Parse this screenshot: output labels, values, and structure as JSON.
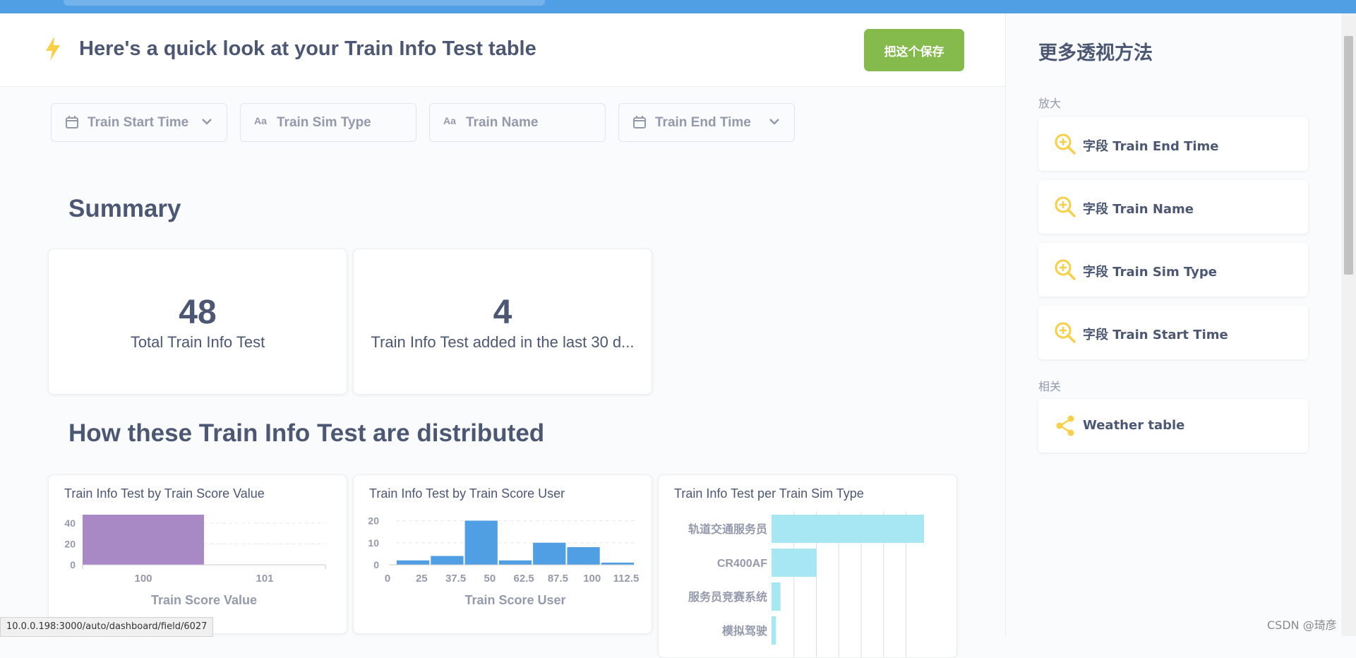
{
  "header": {
    "title": "Here's a quick look at your Train Info Test table",
    "save_label": "把这个保存"
  },
  "filters": [
    {
      "label": "Train Start Time",
      "icon": "calendar-icon",
      "has_dropdown": true
    },
    {
      "label": "Train Sim Type",
      "icon": "text-type-icon",
      "icon_text": "Aa",
      "has_dropdown": false
    },
    {
      "label": "Train Name",
      "icon": "text-type-icon",
      "icon_text": "Aa",
      "has_dropdown": false
    },
    {
      "label": "Train End Time",
      "icon": "calendar-icon",
      "has_dropdown": true
    }
  ],
  "summary": {
    "title": "Summary",
    "cards": [
      {
        "value": "48",
        "label": "Total Train Info Test"
      },
      {
        "value": "4",
        "label": "Train Info Test added in the last 30 d..."
      }
    ]
  },
  "distribution": {
    "title": "How these Train Info Test are distributed"
  },
  "chart_data": [
    {
      "type": "bar",
      "title": "Train Info Test by Train Score Value",
      "xlabel": "Train Score Value",
      "ylabel": "",
      "x_ticks": [
        "100",
        "101"
      ],
      "y_ticks": [
        0,
        20,
        40
      ],
      "ylim": [
        0,
        48
      ],
      "bins": [
        {
          "start": "100",
          "value": 48
        }
      ],
      "color": "#a989c5",
      "grid": true
    },
    {
      "type": "bar",
      "title": "Train Info Test by Train Score User",
      "xlabel": "Train Score User",
      "ylabel": "",
      "x_ticks": [
        "0",
        "25",
        "37.5",
        "50",
        "62.5",
        "87.5",
        "100",
        "112.5"
      ],
      "y_ticks": [
        0,
        10,
        20
      ],
      "ylim": [
        0,
        24
      ],
      "values": [
        2,
        4,
        20,
        2,
        10,
        8,
        1
      ],
      "color": "#509ee3",
      "grid": true
    },
    {
      "type": "bar",
      "orientation": "horizontal",
      "title": "Train Info Test per Train Sim Type",
      "categories": [
        "轨道交通服务员",
        "CR400AF",
        "服务员竞赛系统",
        "模拟驾驶"
      ],
      "values": [
        34,
        10,
        2,
        1
      ],
      "xlim": [
        0,
        40
      ],
      "color": "#a6e7f3",
      "grid": true
    }
  ],
  "sidebar": {
    "title": "更多透视方法",
    "zoom_section": "放大",
    "zoom_items": [
      {
        "label": "字段 Train End Time",
        "icon": "zoom-in-icon"
      },
      {
        "label": "字段 Train Name",
        "icon": "zoom-in-icon"
      },
      {
        "label": "字段 Train Sim Type",
        "icon": "zoom-in-icon"
      },
      {
        "label": "字段 Train Start Time",
        "icon": "zoom-in-icon"
      }
    ],
    "related_section": "相关",
    "related_items": [
      {
        "label": "Weather table",
        "icon": "share-icon"
      }
    ]
  },
  "status_bar": {
    "url": "10.0.0.198:3000/auto/dashboard/field/6027"
  },
  "watermark": "CSDN @琦彦",
  "colors": {
    "brand": "#509ee3",
    "save": "#84bb4c",
    "accent_icon": "#f9cf48",
    "text": "#4c5773",
    "muted": "#949aab"
  }
}
